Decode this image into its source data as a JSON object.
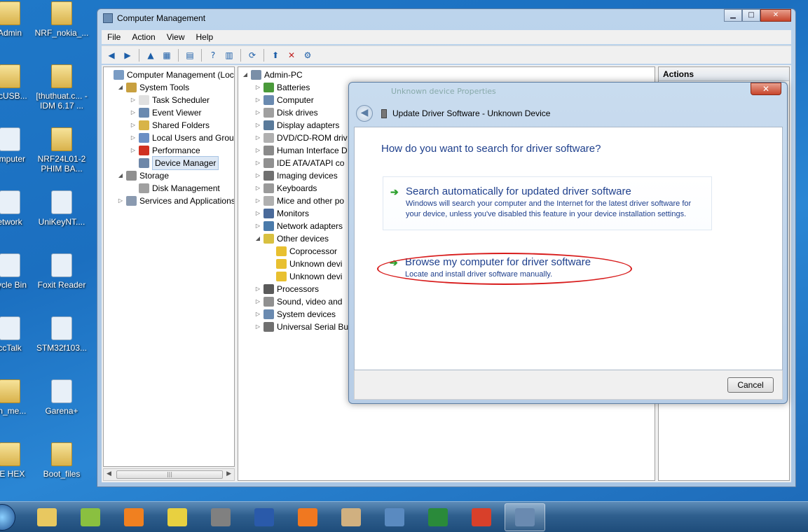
{
  "desktop": {
    "icons": [
      {
        "label": "Admin",
        "x": 0,
        "y": 0,
        "kind": "folder"
      },
      {
        "label": "NRF_nokia_...",
        "x": 0,
        "y": 1,
        "kind": "folder"
      },
      {
        "label": "ificUSB...",
        "x": 1,
        "y": 0,
        "kind": "folder"
      },
      {
        "label": "[thuthuat.c... - IDM 6.17 ...",
        "x": 1,
        "y": 1,
        "kind": "folder"
      },
      {
        "label": "omputer",
        "x": 2,
        "y": 0,
        "kind": "app"
      },
      {
        "label": "NRF24L01-2 PHIM BA...",
        "x": 2,
        "y": 1,
        "kind": "folder"
      },
      {
        "label": "etwork",
        "x": 3,
        "y": 0,
        "kind": "app"
      },
      {
        "label": "UniKeyNT....",
        "x": 3,
        "y": 1,
        "kind": "app"
      },
      {
        "label": "cycle Bin",
        "x": 4,
        "y": 0,
        "kind": "app"
      },
      {
        "label": "Foxit Reader",
        "x": 4,
        "y": 1,
        "kind": "app"
      },
      {
        "label": "ccTalk",
        "x": 5,
        "y": 0,
        "kind": "app"
      },
      {
        "label": "STM32f103...",
        "x": 5,
        "y": 1,
        "kind": "app"
      },
      {
        "label": "an_me...",
        "x": 6,
        "y": 0,
        "kind": "folder"
      },
      {
        "label": "Garena+",
        "x": 6,
        "y": 1,
        "kind": "app"
      },
      {
        "label": "LE HEX",
        "x": 7,
        "y": 0,
        "kind": "folder"
      },
      {
        "label": "Boot_files",
        "x": 7,
        "y": 1,
        "kind": "folder"
      }
    ]
  },
  "window": {
    "title": "Computer Management",
    "minimize": "▁",
    "maximize": "□",
    "close": "✕",
    "menu": [
      "File",
      "Action",
      "View",
      "Help"
    ]
  },
  "tree_left": [
    {
      "label": "Computer Management (Local",
      "level": 0,
      "twisty": "",
      "color": "#7a9cc4"
    },
    {
      "label": "System Tools",
      "level": 1,
      "twisty": "◢",
      "color": "#c8a040"
    },
    {
      "label": "Task Scheduler",
      "level": 2,
      "twisty": "▷",
      "color": "#e0e0e0"
    },
    {
      "label": "Event Viewer",
      "level": 2,
      "twisty": "▷",
      "color": "#6a8ab0"
    },
    {
      "label": "Shared Folders",
      "level": 2,
      "twisty": "▷",
      "color": "#d8b448"
    },
    {
      "label": "Local Users and Groups",
      "level": 2,
      "twisty": "▷",
      "color": "#6b8fc4"
    },
    {
      "label": "Performance",
      "level": 2,
      "twisty": "▷",
      "color": "#d03020"
    },
    {
      "label": "Device Manager",
      "level": 2,
      "twisty": "",
      "color": "#6e87a8",
      "selected": true
    },
    {
      "label": "Storage",
      "level": 1,
      "twisty": "◢",
      "color": "#909090"
    },
    {
      "label": "Disk Management",
      "level": 2,
      "twisty": "",
      "color": "#a0a0a0"
    },
    {
      "label": "Services and Applications",
      "level": 1,
      "twisty": "▷",
      "color": "#8a9ab0"
    }
  ],
  "tree_mid": [
    {
      "label": "Admin-PC",
      "level": 0,
      "twisty": "◢",
      "color": "#7a8fa8"
    },
    {
      "label": "Batteries",
      "level": 1,
      "twisty": "▷",
      "color": "#4a9a3a"
    },
    {
      "label": "Computer",
      "level": 1,
      "twisty": "▷",
      "color": "#6a8ab0"
    },
    {
      "label": "Disk drives",
      "level": 1,
      "twisty": "▷",
      "color": "#a0a0a0"
    },
    {
      "label": "Display adapters",
      "level": 1,
      "twisty": "▷",
      "color": "#5a7a9a"
    },
    {
      "label": "DVD/CD-ROM driv",
      "level": 1,
      "twisty": "▷",
      "color": "#b0b0b0"
    },
    {
      "label": "Human Interface D",
      "level": 1,
      "twisty": "▷",
      "color": "#8a8a8a"
    },
    {
      "label": "IDE ATA/ATAPI co",
      "level": 1,
      "twisty": "▷",
      "color": "#909090"
    },
    {
      "label": "Imaging devices",
      "level": 1,
      "twisty": "▷",
      "color": "#707070"
    },
    {
      "label": "Keyboards",
      "level": 1,
      "twisty": "▷",
      "color": "#9a9a9a"
    },
    {
      "label": "Mice and other po",
      "level": 1,
      "twisty": "▷",
      "color": "#b0b0b0"
    },
    {
      "label": "Monitors",
      "level": 1,
      "twisty": "▷",
      "color": "#4a6a9a"
    },
    {
      "label": "Network adapters",
      "level": 1,
      "twisty": "▷",
      "color": "#4a7aaa"
    },
    {
      "label": "Other devices",
      "level": 1,
      "twisty": "◢",
      "color": "#d8c040"
    },
    {
      "label": "Coprocessor",
      "level": 2,
      "twisty": "",
      "color": "#e8c030"
    },
    {
      "label": "Unknown devi",
      "level": 2,
      "twisty": "",
      "color": "#e8c030"
    },
    {
      "label": "Unknown devi",
      "level": 2,
      "twisty": "",
      "color": "#e8c030"
    },
    {
      "label": "Processors",
      "level": 1,
      "twisty": "▷",
      "color": "#5a5a5a"
    },
    {
      "label": "Sound, video and",
      "level": 1,
      "twisty": "▷",
      "color": "#909090"
    },
    {
      "label": "System devices",
      "level": 1,
      "twisty": "▷",
      "color": "#6a8ab0"
    },
    {
      "label": "Universal Serial Bu",
      "level": 1,
      "twisty": "▷",
      "color": "#707070"
    }
  ],
  "actions": {
    "title": "Actions"
  },
  "dialog": {
    "ghost_title": "Unknown device Properties",
    "close": "✕",
    "header": "Update Driver Software - Unknown Device",
    "question": "How do you want to search for driver software?",
    "option_auto": {
      "title": "Search automatically for updated driver software",
      "desc": "Windows will search your computer and the Internet for the latest driver software for your device, unless you've disabled this feature in your device installation settings."
    },
    "option_browse": {
      "title": "Browse my computer for driver software",
      "desc": "Locate and install driver software manually."
    },
    "cancel": "Cancel"
  },
  "taskbar": {
    "buttons": [
      {
        "name": "explorer",
        "color": "#e8c860"
      },
      {
        "name": "wheel",
        "color": "#8ac040"
      },
      {
        "name": "media-player",
        "color": "#f08020"
      },
      {
        "name": "chip-tool",
        "color": "#e8d040"
      },
      {
        "name": "ic-chip",
        "color": "#808080"
      },
      {
        "name": "isis",
        "color": "#2a5aaa"
      },
      {
        "name": "pdf-tool",
        "color": "#f07820"
      },
      {
        "name": "paint",
        "color": "#d0b080"
      },
      {
        "name": "remote-desktop",
        "color": "#5a8ac0"
      },
      {
        "name": "excel",
        "color": "#2a8a3a"
      },
      {
        "name": "chrome",
        "color": "#d8402a"
      },
      {
        "name": "computer-management",
        "color": "#6a8ab0",
        "active": true
      }
    ]
  }
}
